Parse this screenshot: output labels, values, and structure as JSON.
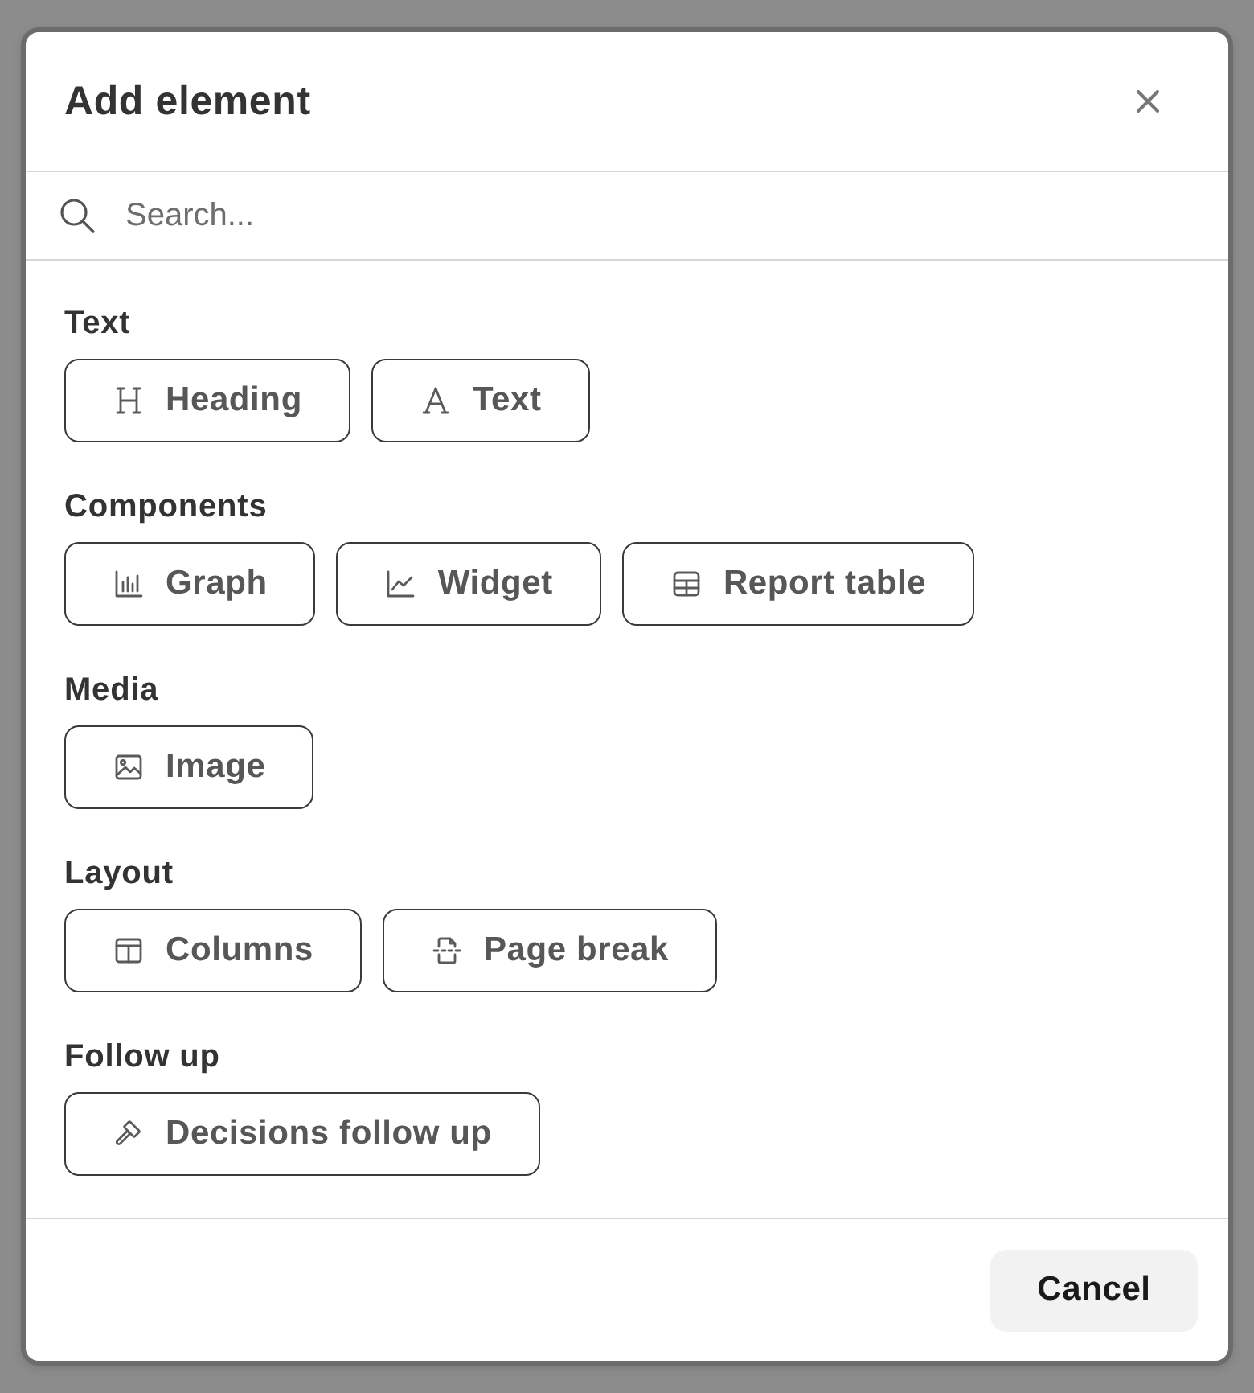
{
  "dialog": {
    "title": "Add element"
  },
  "search": {
    "placeholder": "Search..."
  },
  "sections": [
    {
      "title": "Text",
      "items": [
        {
          "label": "Heading",
          "kind": "heading"
        },
        {
          "label": "Text",
          "kind": "text"
        }
      ]
    },
    {
      "title": "Components",
      "items": [
        {
          "label": "Graph",
          "kind": "graph"
        },
        {
          "label": "Widget",
          "kind": "widget"
        },
        {
          "label": "Report table",
          "kind": "table"
        }
      ]
    },
    {
      "title": "Media",
      "items": [
        {
          "label": "Image",
          "kind": "image"
        }
      ]
    },
    {
      "title": "Layout",
      "items": [
        {
          "label": "Columns",
          "kind": "columns"
        },
        {
          "label": "Page break",
          "kind": "pagebreak"
        }
      ]
    },
    {
      "title": "Follow up",
      "items": [
        {
          "label": "Decisions follow up",
          "kind": "decisions"
        }
      ]
    }
  ],
  "footer": {
    "cancel_button": "Cancel"
  }
}
